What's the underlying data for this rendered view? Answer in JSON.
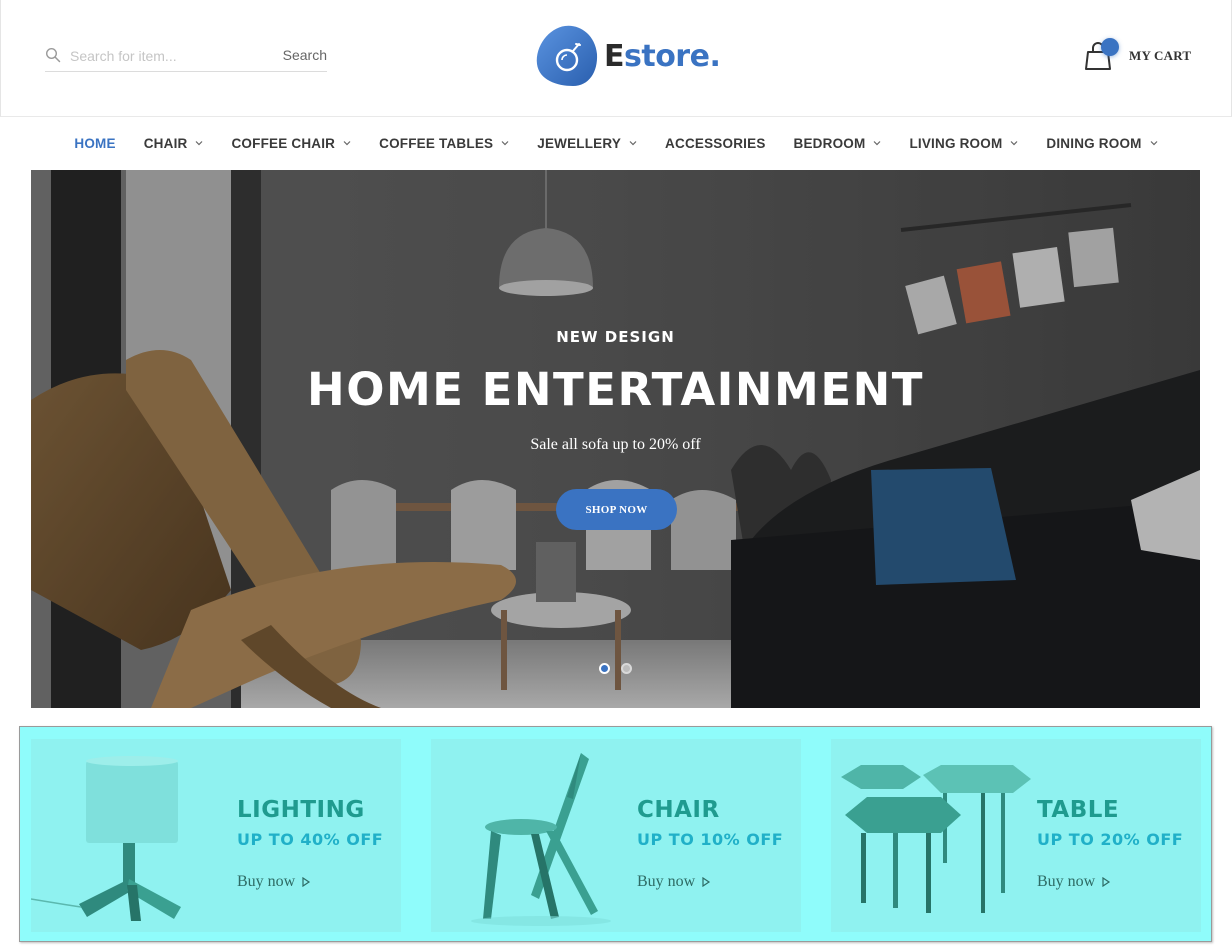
{
  "header": {
    "search": {
      "placeholder": "Search for item...",
      "button_label": "Search"
    },
    "logo": {
      "first_letter": "E",
      "rest": "store."
    },
    "cart": {
      "label": "MY CART"
    }
  },
  "nav": {
    "items": [
      {
        "label": "HOME",
        "active": true,
        "has_dropdown": false
      },
      {
        "label": "CHAIR",
        "has_dropdown": true
      },
      {
        "label": "COFFEE CHAIR",
        "has_dropdown": true
      },
      {
        "label": "COFFEE TABLES",
        "has_dropdown": true
      },
      {
        "label": "JEWELLERY",
        "has_dropdown": true
      },
      {
        "label": "ACCESSORIES",
        "has_dropdown": false
      },
      {
        "label": "BEDROOM",
        "has_dropdown": true
      },
      {
        "label": "LIVING ROOM",
        "has_dropdown": true
      },
      {
        "label": "DINING ROOM",
        "has_dropdown": true
      }
    ]
  },
  "hero": {
    "eyebrow": "NEW DESIGN",
    "headline": "HOME ENTERTAINMENT",
    "subline": "Sale all sofa up to 20% off",
    "cta": "SHOP NOW",
    "slides": 2,
    "active_slide": 1
  },
  "promos": [
    {
      "category": "LIGHTING",
      "offer": "UP TO 40% OFF",
      "cta": "Buy now",
      "icon": "table-lamp"
    },
    {
      "category": "CHAIR",
      "offer": "UP TO 10% OFF",
      "cta": "Buy now",
      "icon": "wooden-chair"
    },
    {
      "category": "TABLE",
      "offer": "UP TO 20% OFF",
      "cta": "Buy now",
      "icon": "nesting-tables"
    }
  ],
  "colors": {
    "accent": "#3a73c2",
    "promo_bg": "#8ffcfb",
    "promo_heading": "#1f9b8f",
    "promo_offer": "#20b0c8"
  }
}
